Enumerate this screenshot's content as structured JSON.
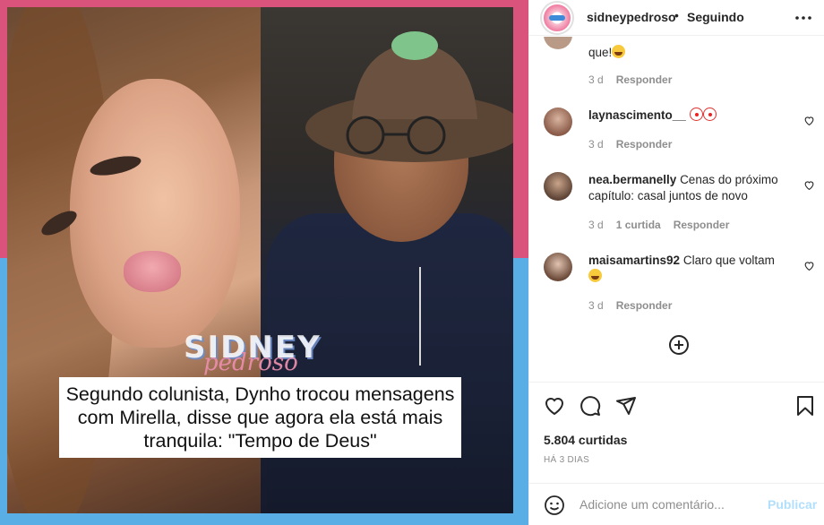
{
  "colors": {
    "bg_top": "#d9537c",
    "bg_bottom": "#5aaee6",
    "link_muted": "#8e8e8e",
    "publish_disabled": "#b2dffc"
  },
  "post": {
    "watermark_main": "SIDNEY",
    "watermark_script": "pedroso",
    "caption_image_text": "Segundo colunista, Dynho trocou mensagens com Mirella, disse que agora ela está mais tranquila: \"Tempo de Deus\""
  },
  "header": {
    "username": "sidneypedroso",
    "separator": "•",
    "follow_status": "Seguindo",
    "more_icon": "more-horizontal-icon"
  },
  "comments": [
    {
      "username": "",
      "text": "que!",
      "emoji": "laugh",
      "time": "3 d",
      "likes": "",
      "reply": "Responder"
    },
    {
      "username": "laynascimento__",
      "text": "",
      "emoji": "clown-clown",
      "time": "3 d",
      "likes": "",
      "reply": "Responder"
    },
    {
      "username": "nea.bermanelly",
      "text": "Cenas do próximo capítulo: casal juntos de novo",
      "time": "3 d",
      "likes": "1 curtida",
      "reply": "Responder"
    },
    {
      "username": "maisamartins92",
      "text": "Claro que voltam",
      "emoji": "laugh",
      "time": "3 d",
      "likes": "",
      "reply": "Responder"
    }
  ],
  "actions": {
    "likes": "5.804 curtidas",
    "time_ago": "HÁ 3 DIAS"
  },
  "add_comment": {
    "placeholder": "Adicione um comentário...",
    "publish_label": "Publicar"
  }
}
